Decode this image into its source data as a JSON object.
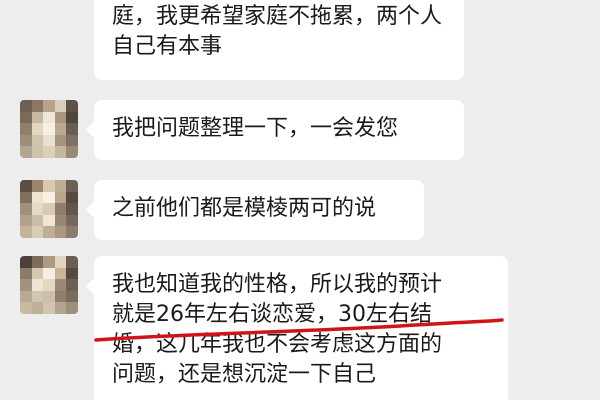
{
  "messages": [
    {
      "lines": [
        "庭，我更希望家庭不拖累，两个人",
        "自己有本事"
      ],
      "has_avatar": false
    },
    {
      "lines": [
        "我把问题整理一下，一会发您"
      ],
      "has_avatar": true
    },
    {
      "lines": [
        "之前他们都是模棱两可的说"
      ],
      "has_avatar": true
    },
    {
      "lines": [
        "我也知道我的性格，所以我的预计",
        "就是26年左右谈恋爱，30左右结",
        "婚，这几年我也不会考虑这方面的",
        "问题，还是想沉淀一下自己"
      ],
      "has_avatar": true
    }
  ],
  "annotation": {
    "color": "#d0141c",
    "type": "hand-drawn underline"
  },
  "colors": {
    "background": "#ededed",
    "bubble": "#ffffff",
    "text": "#1a1a1a"
  },
  "avatar_icon": "blurred-avatar-icon"
}
